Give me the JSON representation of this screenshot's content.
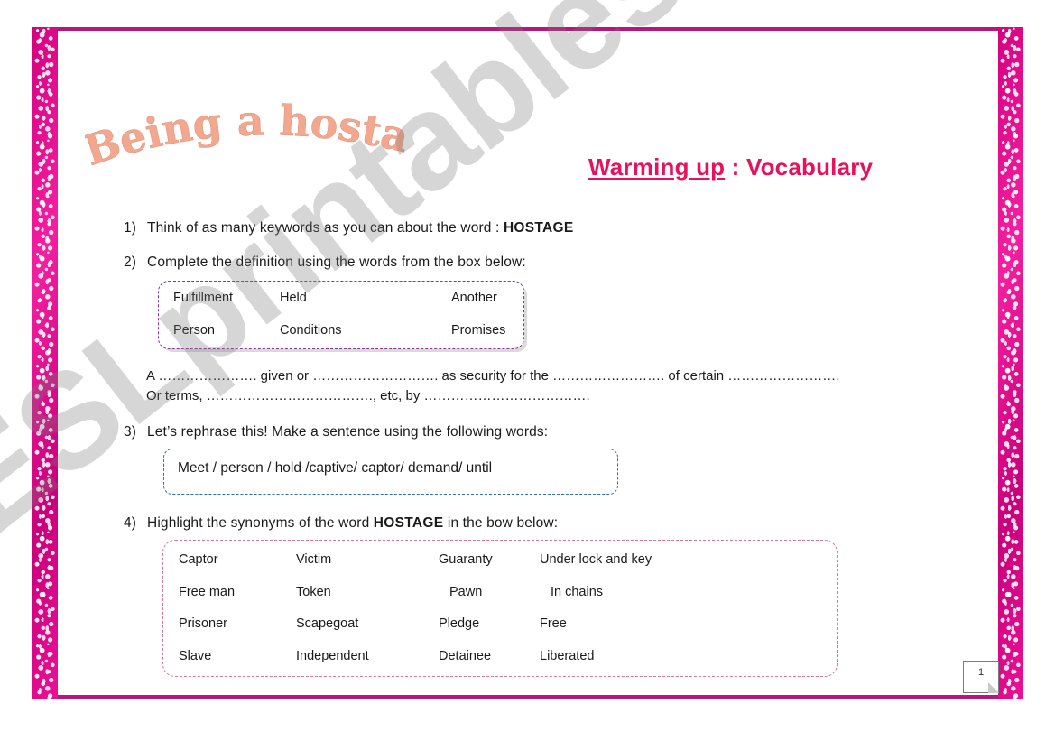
{
  "page": {
    "title_wordart": "Being a hostage...",
    "page_number": "1",
    "watermark": "ESLprintables.com",
    "accent_color": "#e2088e",
    "frame_color": "#b5177e",
    "heading_color": "#e6125c"
  },
  "heading": {
    "underlined_part": "Warming up",
    "separator": " : ",
    "rest": "Vocabulary"
  },
  "exercises": [
    {
      "number": "1)",
      "text_before": "Think of as many keywords as you can about the word : ",
      "bold": "HOSTAGE",
      "text_after": ""
    },
    {
      "number": "2)",
      "text_before": "Complete the definition using the words from the box below:",
      "bold": "",
      "text_after": ""
    },
    {
      "number": "3)",
      "text_before": "Let’s rephrase this! Make a sentence using the following words:",
      "bold": "",
      "text_after": ""
    },
    {
      "number": "4)",
      "text_before": "Highlight the synonyms of the word ",
      "bold": "HOSTAGE",
      "text_after": " in the bow below:"
    }
  ],
  "word_bank": {
    "border_color": "#8b2fa0",
    "rows": [
      [
        "Fulfillment",
        "Held",
        "Another"
      ],
      [
        "Person",
        "Conditions",
        "Promises"
      ]
    ]
  },
  "definition": {
    "line1": "A …………………. given or ………………………. as security for the ……………………. of certain …………………….",
    "line2": "Or terms, ………………………………., etc, by ………………………………."
  },
  "rephrase_box": {
    "border_color": "#2f6fa8",
    "words": "Meet / person / hold /captive/ captor/ demand/  until"
  },
  "synonyms_box": {
    "border_color": "#d4769a",
    "rows": [
      [
        "Captor",
        "Victim",
        "Guaranty",
        "Under lock and key"
      ],
      [
        "Free man",
        "Token",
        "Pawn",
        "In chains"
      ],
      [
        "Prisoner",
        "Scapegoat",
        "Pledge",
        "Free"
      ],
      [
        "Slave",
        "Independent",
        "Detainee",
        "Liberated"
      ]
    ]
  }
}
